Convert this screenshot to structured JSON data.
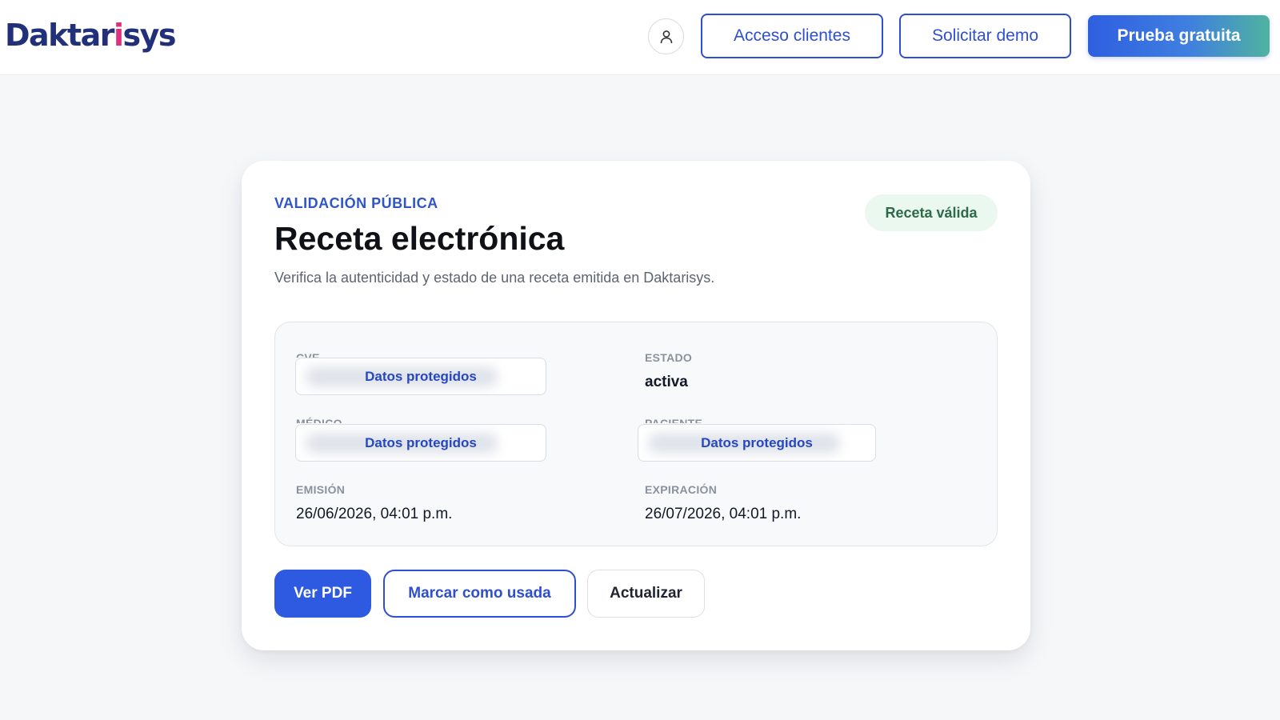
{
  "header": {
    "logo": {
      "part1": "Dakt",
      "part2": "ar",
      "part3": "i",
      "part4": "sys",
      "accent_color": "#e0307b",
      "brand_color": "#22307a"
    },
    "user_icon": "user-icon",
    "client_access_label": "Acceso clientes",
    "request_demo_label": "Solicitar demo",
    "free_trial_label": "Prueba gratuita"
  },
  "card": {
    "eyebrow": "VALIDACIÓN PÚBLICA",
    "title": "Receta electrónica",
    "subtitle": "Verifica la autenticidad y estado de una receta emitida en Daktarisys.",
    "status_badge": "Receta válida",
    "fields": {
      "cve_label": "CVE",
      "cve_value": "Datos protegidos",
      "estado_label": "ESTADO",
      "estado_value": "activa",
      "medico_label": "MÉDICO",
      "medico_value": "Datos protegidos",
      "paciente_label": "PACIENTE",
      "paciente_value": "Datos protegidos",
      "emision_label": "EMISIÓN",
      "emision_value": "26/06/2026, 04:01 p.m.",
      "expiracion_label": "EXPIRACIÓN",
      "expiracion_value": "26/07/2026, 04:01 p.m."
    },
    "actions": {
      "view_pdf": "Ver PDF",
      "mark_used": "Marcar como usada",
      "refresh": "Actualizar"
    }
  },
  "colors": {
    "primary": "#2d5ae0",
    "valid_badge_bg": "#ebf8f0",
    "valid_badge_text": "#2e6a48"
  }
}
